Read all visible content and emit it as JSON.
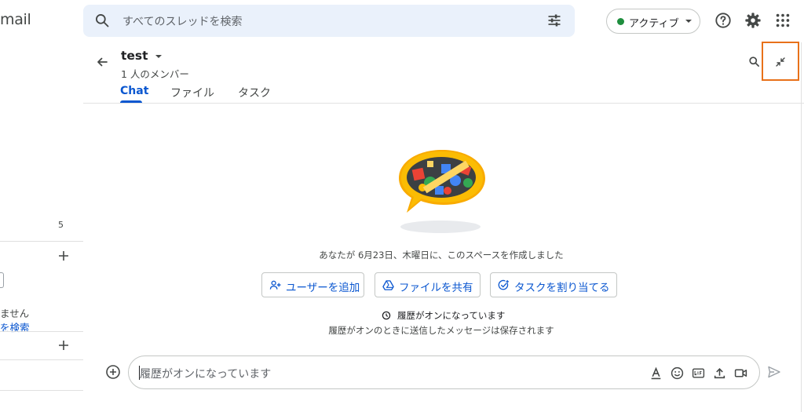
{
  "app": {
    "name": "mail"
  },
  "search": {
    "placeholder": "すべてのスレッドを検索"
  },
  "status": {
    "label": "アクティブ",
    "color": "#1e8e3e"
  },
  "sidebar": {
    "count": "5",
    "empty_text": "ません",
    "search_link": "を検索"
  },
  "space": {
    "title": "test",
    "members": "1 人のメンバー",
    "tabs": [
      {
        "label": "Chat",
        "active": true
      },
      {
        "label": "ファイル",
        "active": false
      },
      {
        "label": "タスク",
        "active": false
      }
    ]
  },
  "content": {
    "created_text": "あなたが 6月23日、木曜日に、このスペースを作成しました",
    "actions": [
      {
        "label": "ユーザーを追加",
        "icon": "person-add-icon"
      },
      {
        "label": "ファイルを共有",
        "icon": "drive-icon"
      },
      {
        "label": "タスクを割り当てる",
        "icon": "task-add-icon"
      }
    ],
    "history_title": "履歴がオンになっています",
    "history_sub": "履歴がオンのときに送信したメッセージは保存されます"
  },
  "composer": {
    "placeholder": "履歴がオンになっています"
  },
  "colors": {
    "accent": "#0b57d0",
    "highlight": "#e8711a"
  }
}
